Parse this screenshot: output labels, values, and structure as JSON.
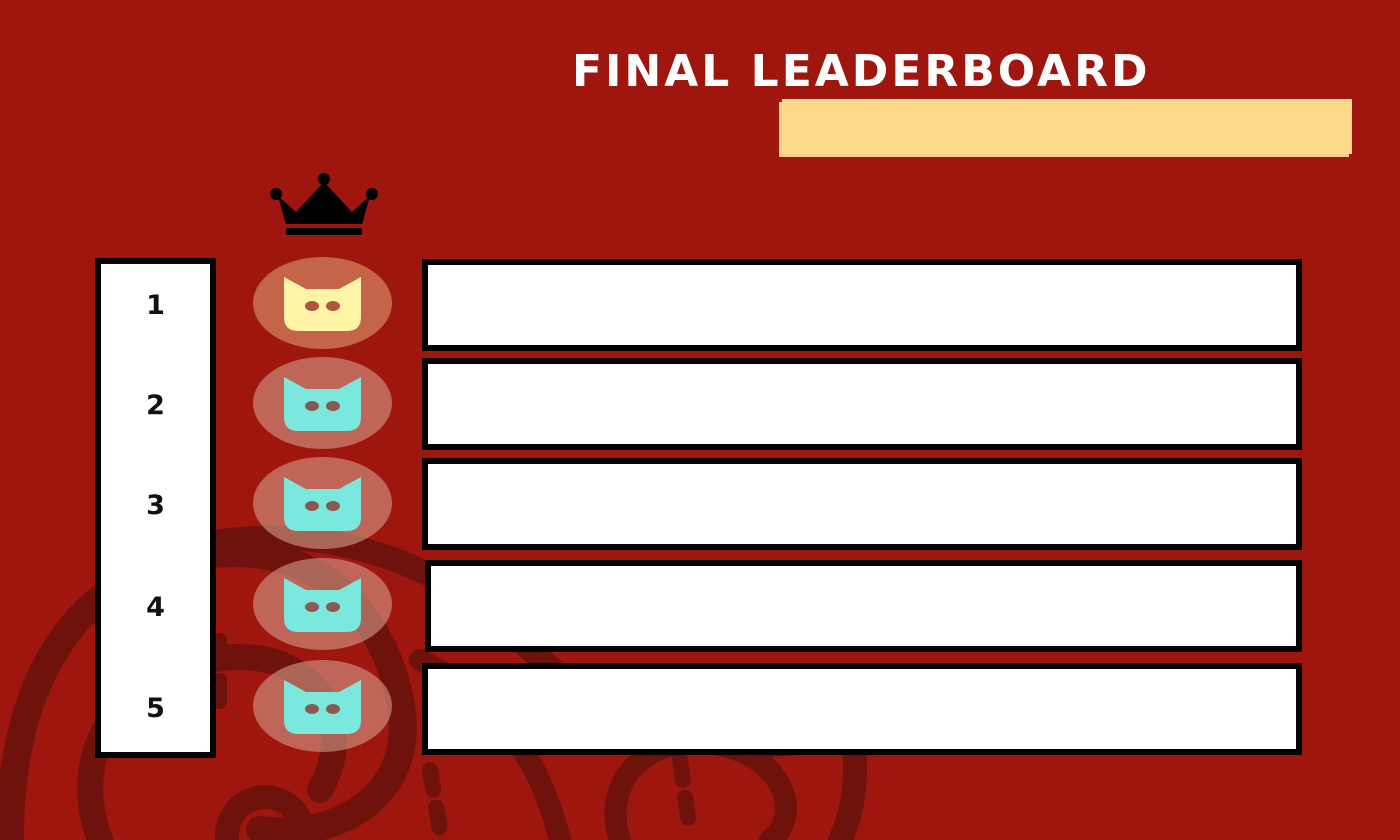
{
  "title": "FINAL LEADERBOARD",
  "colors": {
    "background": "#9e160e",
    "title_bar": "#fdd98a",
    "first_avatar_bg": "#c4654a",
    "first_avatar_icon": "#fff3a6",
    "avatar_icon": "#7ae8dc"
  },
  "leaderboard": {
    "crown_icon": "crown-icon",
    "entries": [
      {
        "rank": "1",
        "avatar_icon": "cat-face-icon",
        "name": ""
      },
      {
        "rank": "2",
        "avatar_icon": "cat-face-icon",
        "name": ""
      },
      {
        "rank": "3",
        "avatar_icon": "cat-face-icon",
        "name": ""
      },
      {
        "rank": "4",
        "avatar_icon": "cat-face-icon",
        "name": ""
      },
      {
        "rank": "5",
        "avatar_icon": "cat-face-icon",
        "name": ""
      }
    ]
  }
}
